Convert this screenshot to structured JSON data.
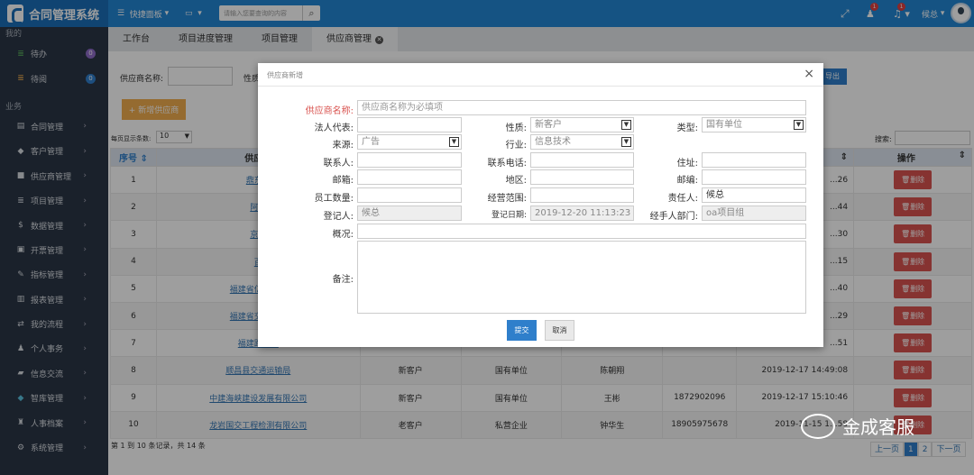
{
  "app": {
    "title": "合同管理系统"
  },
  "topbar": {
    "quick": "快捷面板",
    "search_placeholder": "请输入您要查询的内容",
    "notif1": "1",
    "notif2": "1",
    "user": "候总"
  },
  "sidebar": {
    "sec1": "我的",
    "sec2": "业务",
    "todo": {
      "label": "待办",
      "count": "0"
    },
    "read": {
      "label": "待阅",
      "count": "0"
    },
    "items": [
      "合同管理",
      "客户管理",
      "供应商管理",
      "项目管理",
      "数据管理",
      "开票管理",
      "指标管理",
      "报表管理",
      "我的流程",
      "个人事务",
      "信息交流",
      "智库管理",
      "人事档案",
      "系统管理"
    ]
  },
  "tabs": [
    "工作台",
    "项目进度管理",
    "项目管理",
    "供应商管理"
  ],
  "filter": {
    "name_label": "供应商名称:",
    "nature_label": "性质"
  },
  "toolbar": {
    "add_label": "+ 新增供应商",
    "export_label": "导出",
    "page_size_label": "每页显示条数:",
    "page_size": "10",
    "search_label": "搜索:"
  },
  "table": {
    "headers": [
      "序号",
      "供应商",
      "",
      "",
      "",
      "",
      "",
      "操作"
    ],
    "rows": [
      {
        "no": "1",
        "name": "鼎东信",
        "type": "",
        "ind": "",
        "person": "",
        "phone": "",
        "date": "...26"
      },
      {
        "no": "2",
        "name": "阿里",
        "type": "",
        "ind": "",
        "person": "",
        "phone": "",
        "date": "...44"
      },
      {
        "no": "3",
        "name": "京东",
        "type": "",
        "ind": "",
        "person": "",
        "phone": "",
        "date": "...30"
      },
      {
        "no": "4",
        "name": "百",
        "type": "",
        "ind": "",
        "person": "",
        "phone": "",
        "date": "...15"
      },
      {
        "no": "5",
        "name": "福建省亿禾建设",
        "type": "",
        "ind": "",
        "person": "",
        "phone": "",
        "date": "...40"
      },
      {
        "no": "6",
        "name": "福建省交通建设",
        "type": "",
        "ind": "",
        "person": "",
        "phone": "",
        "date": "...29"
      },
      {
        "no": "7",
        "name": "福建路桥建",
        "type": "",
        "ind": "",
        "person": "",
        "phone": "",
        "date": "...51"
      },
      {
        "no": "8",
        "name": "顺昌县交通运输局",
        "type": "新客户",
        "ind": "国有单位",
        "person": "陈朝翔",
        "phone": "",
        "date": "2019-12-17 14:49:08"
      },
      {
        "no": "9",
        "name": "中建海峡建设发展有限公司",
        "type": "新客户",
        "ind": "国有单位",
        "person": "王彬",
        "phone": "1872902096",
        "date": "2019-12-17 15:10:46"
      },
      {
        "no": "10",
        "name": "龙岩国交工程检测有限公司",
        "type": "老客户",
        "ind": "私营企业",
        "person": "钟华生",
        "phone": "18905975678",
        "date": "2019-11-15 1...58"
      }
    ],
    "delete_label": "删除"
  },
  "footer": {
    "summary": "第 1 到 10 条记录，共 14 条",
    "prev": "上一页",
    "p1": "1",
    "p2": "2",
    "next": "下一页"
  },
  "watermark": "金成客服",
  "modal": {
    "title": "供应商新增",
    "labels": {
      "name": "供应商名称:",
      "legal": "法人代表:",
      "nature": "性质:",
      "type": "类型:",
      "source": "来源:",
      "industry": "行业:",
      "address": "住址:",
      "contact": "联系人:",
      "phone": "联系电话:",
      "email": "邮箱:",
      "region": "地区:",
      "zip": "邮编:",
      "staff": "员工数量:",
      "scope": "经营范围:",
      "owner": "责任人:",
      "registrant": "登记人:",
      "reg_date": "登记日期:",
      "dept": "经手人部门:",
      "overview": "概况:",
      "remark": "备注:"
    },
    "values": {
      "name_placeholder": "供应商名称为必填项",
      "nature": "新客户",
      "type": "国有单位",
      "source": "广告",
      "industry": "信息技术",
      "owner": "候总",
      "registrant": "候总",
      "reg_date": "2019-12-20 11:13:23",
      "dept": "oa项目组"
    },
    "submit": "提交",
    "cancel": "取消"
  }
}
